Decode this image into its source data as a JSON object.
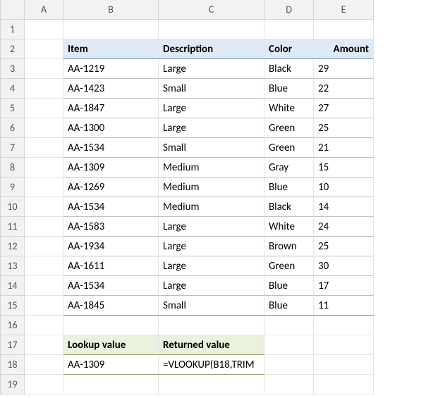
{
  "columns": [
    "A",
    "B",
    "C",
    "D",
    "E"
  ],
  "rows": [
    "1",
    "2",
    "3",
    "4",
    "5",
    "6",
    "7",
    "8",
    "9",
    "10",
    "11",
    "12",
    "13",
    "14",
    "15",
    "16",
    "17",
    "18",
    "19"
  ],
  "headers": {
    "item": "Item",
    "description": "Description",
    "color": "Color",
    "amount": "Amount"
  },
  "table": [
    {
      "item": "AA-1219",
      "description": "Large",
      "color": "Black",
      "amount": "29"
    },
    {
      "item": "AA-1423",
      "description": "Small",
      "color": "Blue",
      "amount": "22"
    },
    {
      "item": "AA-1847",
      "description": "Large",
      "color": "White",
      "amount": "27"
    },
    {
      "item": "AA-1300",
      "description": "Large",
      "color": "Green",
      "amount": "25"
    },
    {
      "item": "AA-1534",
      "description": "Small",
      "color": "Green",
      "amount": "21"
    },
    {
      "item": "AA-1309",
      "description": "Medium",
      "color": "Gray",
      "amount": "15"
    },
    {
      "item": "AA-1269",
      "description": "Medium",
      "color": "Blue",
      "amount": "10"
    },
    {
      "item": "AA-1534",
      "description": "Medium",
      "color": "Black",
      "amount": "14"
    },
    {
      "item": "AA-1583",
      "description": "Large",
      "color": "White",
      "amount": "24"
    },
    {
      "item": "AA-1934",
      "description": "Large",
      "color": "Brown",
      "amount": "25"
    },
    {
      "item": "AA-1611",
      "description": "Large",
      "color": "Green",
      "amount": "30"
    },
    {
      "item": "AA-1534",
      "description": "Large",
      "color": "Blue",
      "amount": "17"
    },
    {
      "item": "AA-1845",
      "description": "Small",
      "color": "Blue",
      "amount": "11"
    }
  ],
  "lookup": {
    "lookup_value_label": "Lookup value",
    "returned_value_label": "Returned value",
    "lookup_value": "AA-1309",
    "formula": "=VLOOKUP(B18,TRIM"
  },
  "chart_data": {
    "type": "table",
    "title": "",
    "columns": [
      "Item",
      "Description",
      "Color",
      "Amount"
    ],
    "rows": [
      [
        "AA-1219",
        "Large",
        "Black",
        29
      ],
      [
        "AA-1423",
        "Small",
        "Blue",
        22
      ],
      [
        "AA-1847",
        "Large",
        "White",
        27
      ],
      [
        "AA-1300",
        "Large",
        "Green",
        25
      ],
      [
        "AA-1534",
        "Small",
        "Green",
        21
      ],
      [
        "AA-1309",
        "Medium",
        "Gray",
        15
      ],
      [
        "AA-1269",
        "Medium",
        "Blue",
        10
      ],
      [
        "AA-1534",
        "Medium",
        "Black",
        14
      ],
      [
        "AA-1583",
        "Large",
        "White",
        24
      ],
      [
        "AA-1934",
        "Large",
        "Brown",
        25
      ],
      [
        "AA-1611",
        "Large",
        "Green",
        30
      ],
      [
        "AA-1534",
        "Large",
        "Blue",
        17
      ],
      [
        "AA-1845",
        "Small",
        "Blue",
        11
      ]
    ]
  }
}
